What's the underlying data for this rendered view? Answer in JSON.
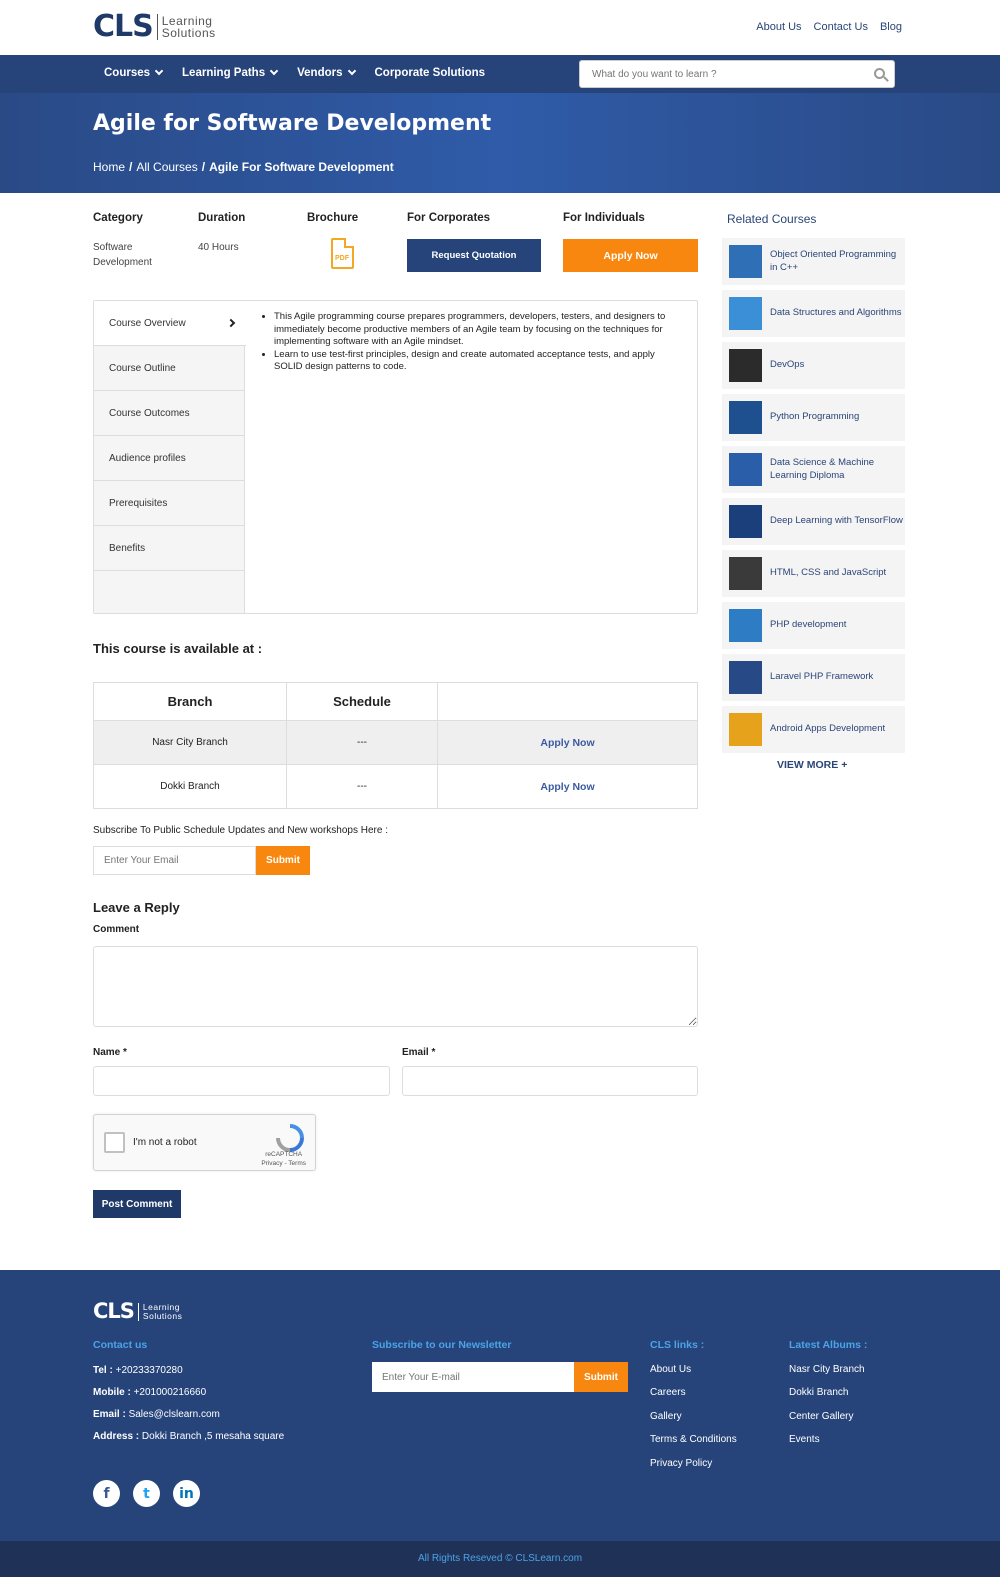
{
  "header": {
    "logo_mark": "CLS",
    "logo_text_line1": "Learning",
    "logo_text_line2": "Solutions",
    "top_links": [
      "About Us",
      "Contact Us",
      "Blog"
    ]
  },
  "nav": {
    "items": [
      {
        "label": "Courses",
        "dropdown": true
      },
      {
        "label": "Learning Paths",
        "dropdown": true
      },
      {
        "label": "Vendors",
        "dropdown": true
      },
      {
        "label": "Corporate Solutions",
        "dropdown": false
      }
    ],
    "search_placeholder": "What do you want to learn ?"
  },
  "hero": {
    "title": "Agile for Software Development",
    "breadcrumb": [
      "Home",
      "All Courses",
      "Agile For Software Development"
    ]
  },
  "info": {
    "category_label": "Category",
    "category_value": "Software Development",
    "duration_label": "Duration",
    "duration_value": "40 Hours",
    "brochure_label": "Brochure",
    "brochure_icon": "pdf-icon",
    "brochure_icon_text": "PDF",
    "corporates_label": "For Corporates",
    "corporates_button": "Request Quotation",
    "individuals_label": "For Individuals",
    "individuals_button": "Apply Now"
  },
  "tabs": {
    "items": [
      "Course Overview",
      "Course Outline",
      "Course Outcomes",
      "Audience profiles",
      "Prerequisites",
      "Benefits"
    ],
    "active": "Course Overview",
    "content": [
      "This Agile programming course prepares programmers, developers, testers, and designers to immediately become productive members of an Agile team by focusing on the techniques for implementing software with an Agile mindset.",
      "Learn to use test-first principles, design and create automated acceptance tests, and apply SOLID design patterns to code."
    ]
  },
  "availability": {
    "title": "This course is available at :",
    "headers": [
      "Branch",
      "Schedule",
      ""
    ],
    "rows": [
      {
        "branch": "Nasr City Branch",
        "schedule": "---",
        "action": "Apply Now"
      },
      {
        "branch": "Dokki Branch",
        "schedule": "---",
        "action": "Apply Now"
      }
    ]
  },
  "subscribe": {
    "text": "Subscribe To Public Schedule Updates and New workshops Here :",
    "placeholder": "Enter Your Email",
    "button": "Submit"
  },
  "reply": {
    "title": "Leave a Reply",
    "comment_label": "Comment",
    "name_label": "Name *",
    "email_label": "Email *",
    "captcha_text": "I'm not a robot",
    "captcha_brand": "reCAPTCHA",
    "captcha_links": "Privacy - Terms",
    "post_button": "Post Comment"
  },
  "sidebar": {
    "title": "Related Courses",
    "items": [
      {
        "label": "Object Oriented Programming in C++",
        "color": "#2f6fb5"
      },
      {
        "label": "Data Structures and Algorithms",
        "color": "#3b8fd6"
      },
      {
        "label": "DevOps",
        "color": "#2b2b2b"
      },
      {
        "label": "Python Programming",
        "color": "#1e4f8f"
      },
      {
        "label": "Data Science & Machine Learning Diploma",
        "color": "#2a5ea8"
      },
      {
        "label": "Deep Learning with TensorFlow",
        "color": "#1a3f7a"
      },
      {
        "label": "HTML, CSS and JavaScript",
        "color": "#3a3a3a"
      },
      {
        "label": "PHP development",
        "color": "#2e7cc4"
      },
      {
        "label": "Laravel PHP Framework",
        "color": "#274a86"
      },
      {
        "label": "Android Apps Development",
        "color": "#e5a21a"
      }
    ],
    "view_more": "VIEW MORE"
  },
  "footer": {
    "contact_heading": "Contact us",
    "tel_label": "Tel :",
    "tel": "+20233370280",
    "mobile_label": "Mobile :",
    "mobile": "+201000216660",
    "email_label": "Email :",
    "email": "Sales@clslearn.com",
    "address_label": "Address :",
    "address": "Dokki Branch ,5 mesaha square",
    "newsletter_heading": "Subscribe to our Newsletter",
    "newsletter_placeholder": "Enter Your E-mail",
    "newsletter_button": "Submit",
    "links_heading": "CLS links :",
    "links": [
      "About Us",
      "Careers",
      "Gallery",
      "Terms & Conditions",
      "Privacy Policy"
    ],
    "albums_heading": "Latest Albums :",
    "albums": [
      "Nasr City Branch",
      "Dokki Branch",
      "Center Gallery",
      "Events"
    ],
    "social": [
      "f",
      "t",
      "in"
    ],
    "copyright": "All Rights Reseved © CLSLearn.com"
  }
}
